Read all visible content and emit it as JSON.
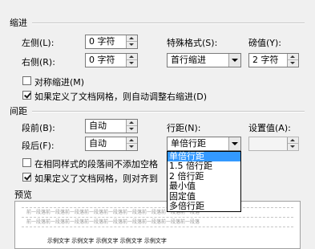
{
  "indent": {
    "title": "缩进",
    "left_label": "左侧(L):",
    "left_value": "0 字符",
    "right_label": "右侧(R):",
    "right_value": "0 字符",
    "special_label": "特殊格式(S):",
    "special_value": "首行缩进",
    "by_label": "磅值(Y):",
    "by_value": "2 字符",
    "mirror_label": "对称缩进(M)",
    "mirror_checked": false,
    "auto_right_label": "如果定义了文档网格，则自动调整右缩进(D)",
    "auto_right_checked": true
  },
  "spacing": {
    "title": "间距",
    "before_label": "段前(B):",
    "before_value": "自动",
    "after_label": "段后(F):",
    "after_value": "自动",
    "line_spacing_label": "行距(N):",
    "line_spacing_value": "单倍行距",
    "at_label": "设置值(A):",
    "at_value": "",
    "no_space_label": "在相同样式的段落间不添加空格",
    "no_space_checked": false,
    "snap_grid_label": "如果定义了文档网格，则对齐到",
    "snap_grid_checked": true,
    "line_spacing_options": [
      "单倍行距",
      "1.5 倍行距",
      "2 倍行距",
      "最小值",
      "固定值",
      "多倍行距"
    ]
  },
  "preview": {
    "title": "预览",
    "sample_grey": "前一段落前一段落前一段落前一段落前一段落前一段落前一段落前一段落前一段落",
    "sample_text": "示例文字 示例文字 示例文字 示例文字 示例文字"
  },
  "colors": {
    "selection": "#3399ff",
    "dialog_bg": "#f0f0f0"
  }
}
